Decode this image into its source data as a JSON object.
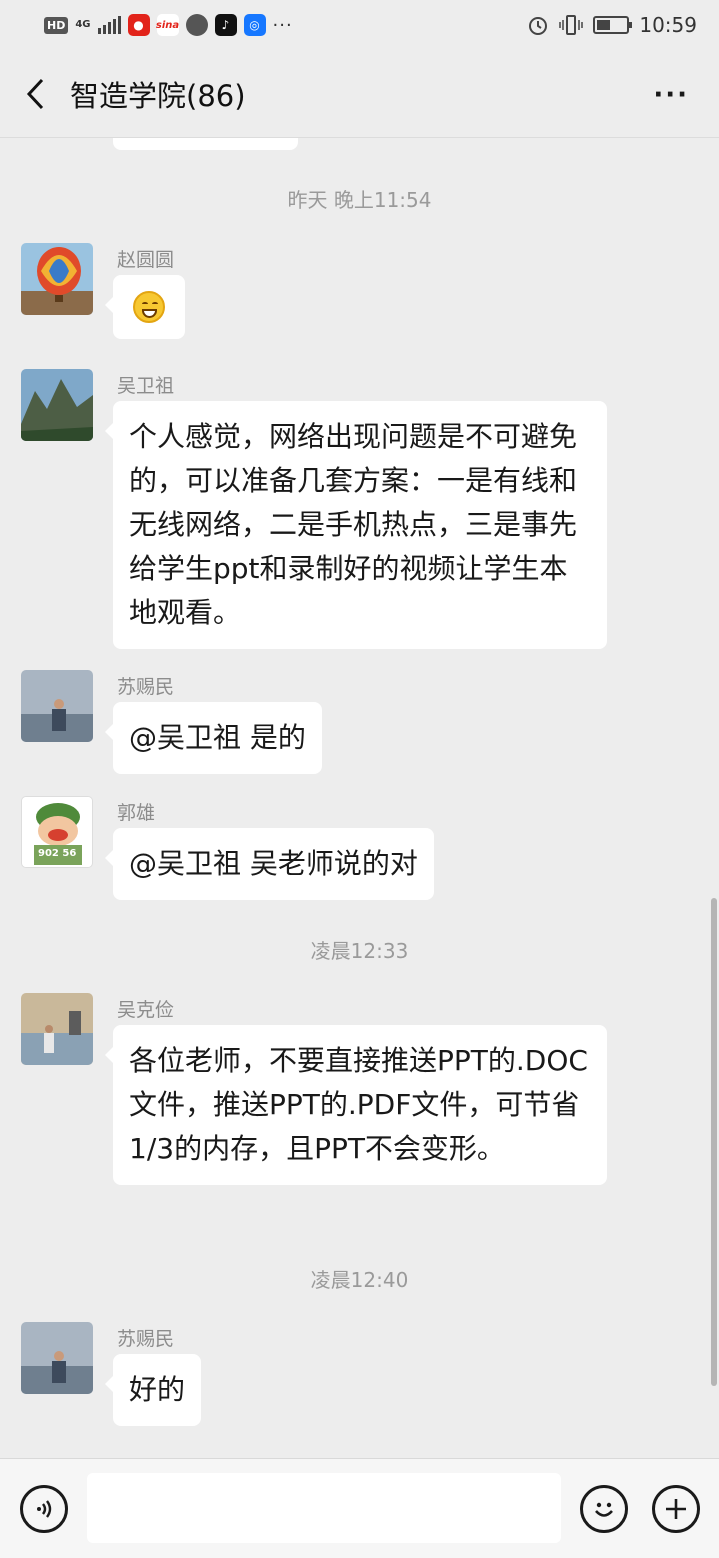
{
  "status_bar": {
    "hd_badge": "HD",
    "network": "4G",
    "app_icons": [
      "weibo-icon",
      "sina-icon",
      "message-icon",
      "tiktok-icon",
      "map-icon"
    ],
    "app_labels": [
      "",
      "sina",
      "",
      "",
      ""
    ],
    "more": "···",
    "time": "10:59",
    "battery_level": 0.4
  },
  "header": {
    "title": "智造学院(86)",
    "more_label": "···"
  },
  "messages": [
    {
      "type": "time",
      "text": "昨天 晚上11:54"
    },
    {
      "type": "msg",
      "sender": "赵圆圆",
      "avatar": "hot-air-balloon",
      "content": "",
      "emoji": "grin-emoji"
    },
    {
      "type": "msg",
      "sender": "吴卫祖",
      "avatar": "mountain-landscape",
      "content": "个人感觉，网络出现问题是不可避免的，可以准备几套方案：一是有线和无线网络，二是手机热点，三是事先给学生ppt和录制好的视频让学生本地观看。"
    },
    {
      "type": "msg",
      "sender": "苏赐民",
      "avatar": "person-by-lake",
      "content": "@吴卫祖  是的"
    },
    {
      "type": "msg",
      "sender": "郭雄",
      "avatar": "cartoon-soldier",
      "avatar_text": "902 56",
      "content": "@吴卫祖  吴老师说的对"
    },
    {
      "type": "time",
      "text": "凌晨12:33"
    },
    {
      "type": "msg",
      "sender": "吴克俭",
      "avatar": "person-at-pier",
      "content": "各位老师，不要直接推送PPT的.DOC文件，推送PPT的.PDF文件，可节省1/3的内存，且PPT不会变形。"
    },
    {
      "type": "time",
      "text": "凌晨12:40"
    },
    {
      "type": "msg",
      "sender": "苏赐民",
      "avatar": "person-by-lake",
      "content": "好的"
    }
  ],
  "input_bar": {
    "voice_icon": "voice-icon",
    "placeholder": "",
    "emoji_icon": "emoji-icon",
    "plus_icon": "plus-icon"
  }
}
